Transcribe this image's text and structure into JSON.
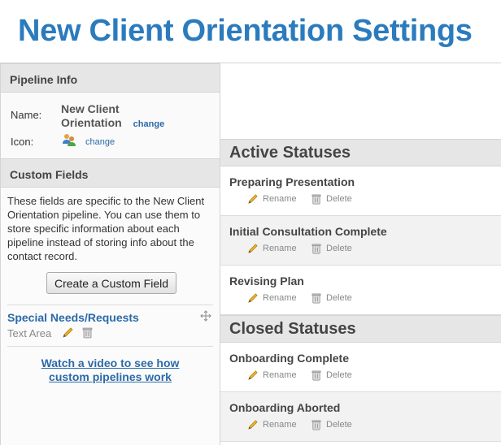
{
  "page_title": "New Client Orientation Settings",
  "pipeline_info": {
    "header": "Pipeline Info",
    "name_label": "Name:",
    "name_line1": "New Client",
    "name_line2": "Orientation",
    "name_change": "change",
    "icon_label": "Icon:",
    "icon": "people-icon",
    "icon_change": "change"
  },
  "custom_fields": {
    "header": "Custom Fields",
    "description": "These fields are specific to the New Client Orientation pipeline. You can use them to store specific information about each pipeline instead of storing info about the contact record.",
    "create_button": "Create a Custom Field",
    "fields": [
      {
        "name": "Special Needs/Requests",
        "type": "Text Area"
      }
    ],
    "video_link_line1": "Watch a video to see how",
    "video_link_line2": "custom pipelines work"
  },
  "active_statuses": {
    "header": "Active Statuses",
    "items": [
      {
        "name": "Preparing Presentation",
        "rename": "Rename",
        "delete": "Delete"
      },
      {
        "name": "Initial Consultation Complete",
        "rename": "Rename",
        "delete": "Delete"
      },
      {
        "name": "Revising Plan",
        "rename": "Rename",
        "delete": "Delete"
      }
    ]
  },
  "closed_statuses": {
    "header": "Closed Statuses",
    "items": [
      {
        "name": "Onboarding Complete",
        "rename": "Rename",
        "delete": "Delete"
      },
      {
        "name": "Onboarding Aborted",
        "rename": "Rename",
        "delete": "Delete"
      }
    ]
  },
  "colors": {
    "title": "#2b7bbd",
    "link": "#2b6aa8",
    "header_bg": "#e6e6e6",
    "row_alt_bg": "#f2f2f2"
  }
}
